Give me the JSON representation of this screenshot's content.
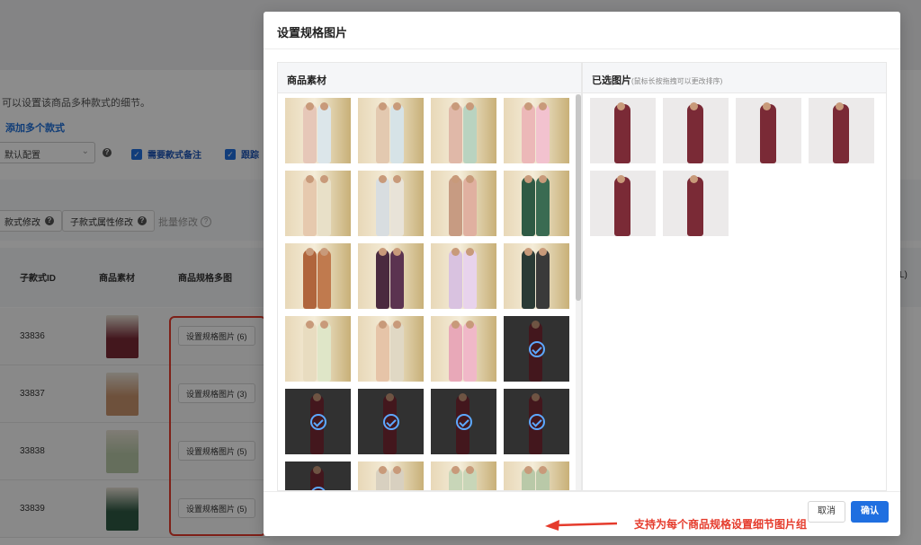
{
  "background": {
    "hint_text": "可以设置该商品多种款式的细节。",
    "add_link": "添加多个款式",
    "config_select": "默认配置",
    "check_remark": "需要款式备注",
    "check_track": "跟踪",
    "btn_style_edit": "款式修改",
    "btn_attr_edit": "子款式属性修改",
    "batch_edit": "批量修改",
    "columns": [
      "子款式ID",
      "商品素材",
      "商品规格多图"
    ],
    "right_ghost": "L)",
    "rows": [
      {
        "id": "33836",
        "btn": "设置规格图片 (6)",
        "color": "#7a2a36"
      },
      {
        "id": "33837",
        "btn": "设置规格图片 (3)",
        "color": "#c9946d"
      },
      {
        "id": "33838",
        "btn": "设置规格图片 (5)",
        "color": "#b9c9a8"
      },
      {
        "id": "33839",
        "btn": "设置规格图片 (5)",
        "color": "#2f5a44"
      }
    ]
  },
  "modal": {
    "title": "设置规格图片",
    "left_panel_title": "商品素材",
    "right_panel_title": "已选图片",
    "right_panel_hint": "(鼠标长按拖拽可以更改排序)",
    "cancel_label": "取消",
    "confirm_label": "确认",
    "selected_count": 6
  },
  "annotation": {
    "text": "支持为每个商品规格设置细节图片组",
    "color": "#e53b2c"
  },
  "materials": [
    {
      "colors": [
        "#e6c7b8",
        "#dce6ea"
      ],
      "selected": false
    },
    {
      "colors": [
        "#e3c9b0",
        "#d6e3e7"
      ],
      "selected": false
    },
    {
      "colors": [
        "#e0b8a8",
        "#b9d3c0"
      ],
      "selected": false
    },
    {
      "colors": [
        "#ecb8b8",
        "#f2c2cf"
      ],
      "selected": false
    },
    {
      "colors": [
        "#e6c9ae",
        "#e8e0c8"
      ],
      "selected": false
    },
    {
      "colors": [
        "#d8dde0",
        "#e8e3d8"
      ],
      "selected": false
    },
    {
      "colors": [
        "#c79b82",
        "#e0b0a0"
      ],
      "selected": false
    },
    {
      "colors": [
        "#2f5a44",
        "#3a6b52"
      ],
      "selected": false
    },
    {
      "colors": [
        "#b0653c",
        "#c07a4e"
      ],
      "selected": false
    },
    {
      "colors": [
        "#4a2a3f",
        "#5b3350"
      ],
      "selected": false
    },
    {
      "colors": [
        "#d9c2e0",
        "#e8d3ec"
      ],
      "selected": false
    },
    {
      "colors": [
        "#2a3a35",
        "#3a3a3a"
      ],
      "selected": false
    },
    {
      "colors": [
        "#e8dcc0",
        "#dfe6c8"
      ],
      "selected": false
    },
    {
      "colors": [
        "#e6c4a8",
        "#e0d8c4"
      ],
      "selected": false
    },
    {
      "colors": [
        "#e8a8b8",
        "#f0b8c8"
      ],
      "selected": false
    },
    {
      "colors": [
        "#7a2a36",
        "#7a2a36"
      ],
      "selected": true
    },
    {
      "colors": [
        "#7a2a36",
        "#7a2a36"
      ],
      "selected": true
    },
    {
      "colors": [
        "#7a2a36",
        "#7a2a36"
      ],
      "selected": true
    },
    {
      "colors": [
        "#7a2a36",
        "#7a2a36"
      ],
      "selected": true
    },
    {
      "colors": [
        "#7a2a36",
        "#7a2a36"
      ],
      "selected": true
    },
    {
      "colors": [
        "#7a2a36",
        "#7a2a36"
      ],
      "selected": true
    },
    {
      "colors": [
        "#d8d0c0",
        "#d8d0c0"
      ],
      "selected": false
    },
    {
      "colors": [
        "#c8d6b8",
        "#c8d6b8"
      ],
      "selected": false
    },
    {
      "colors": [
        "#b9c9a8",
        "#b9c9a8"
      ],
      "selected": false
    }
  ]
}
